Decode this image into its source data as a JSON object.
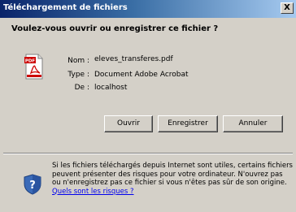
{
  "window": {
    "title": "Téléchargement de fichiers",
    "close_label": "X"
  },
  "dialog": {
    "question": "Voulez-vous ouvrir ou enregistrer ce fichier ?",
    "file_icon": "pdf-file-icon",
    "fields": {
      "name_label": "Nom :",
      "name_value": "eleves_transferes.pdf",
      "type_label": "Type :",
      "type_value": "Document Adobe Acrobat",
      "from_label": "De :",
      "from_value": "localhost"
    },
    "buttons": {
      "open": "Ouvrir",
      "save": "Enregistrer",
      "cancel": "Annuler"
    },
    "warning": {
      "icon": "shield-question-icon",
      "text": "Si les fichiers téléchargés depuis Internet sont utiles, certains fichiers peuvent présenter des risques pour votre ordinateur. N'ouvrez pas ou n'enregistrez pas ce fichier si vous n'êtes pas sûr de son origine.",
      "link": "Quels sont les risques ?"
    }
  },
  "colors": {
    "title_bar_start": "#0a246a",
    "title_bar_end": "#a6caf0",
    "window_face": "#d4d0c8",
    "link": "#0000ee"
  }
}
